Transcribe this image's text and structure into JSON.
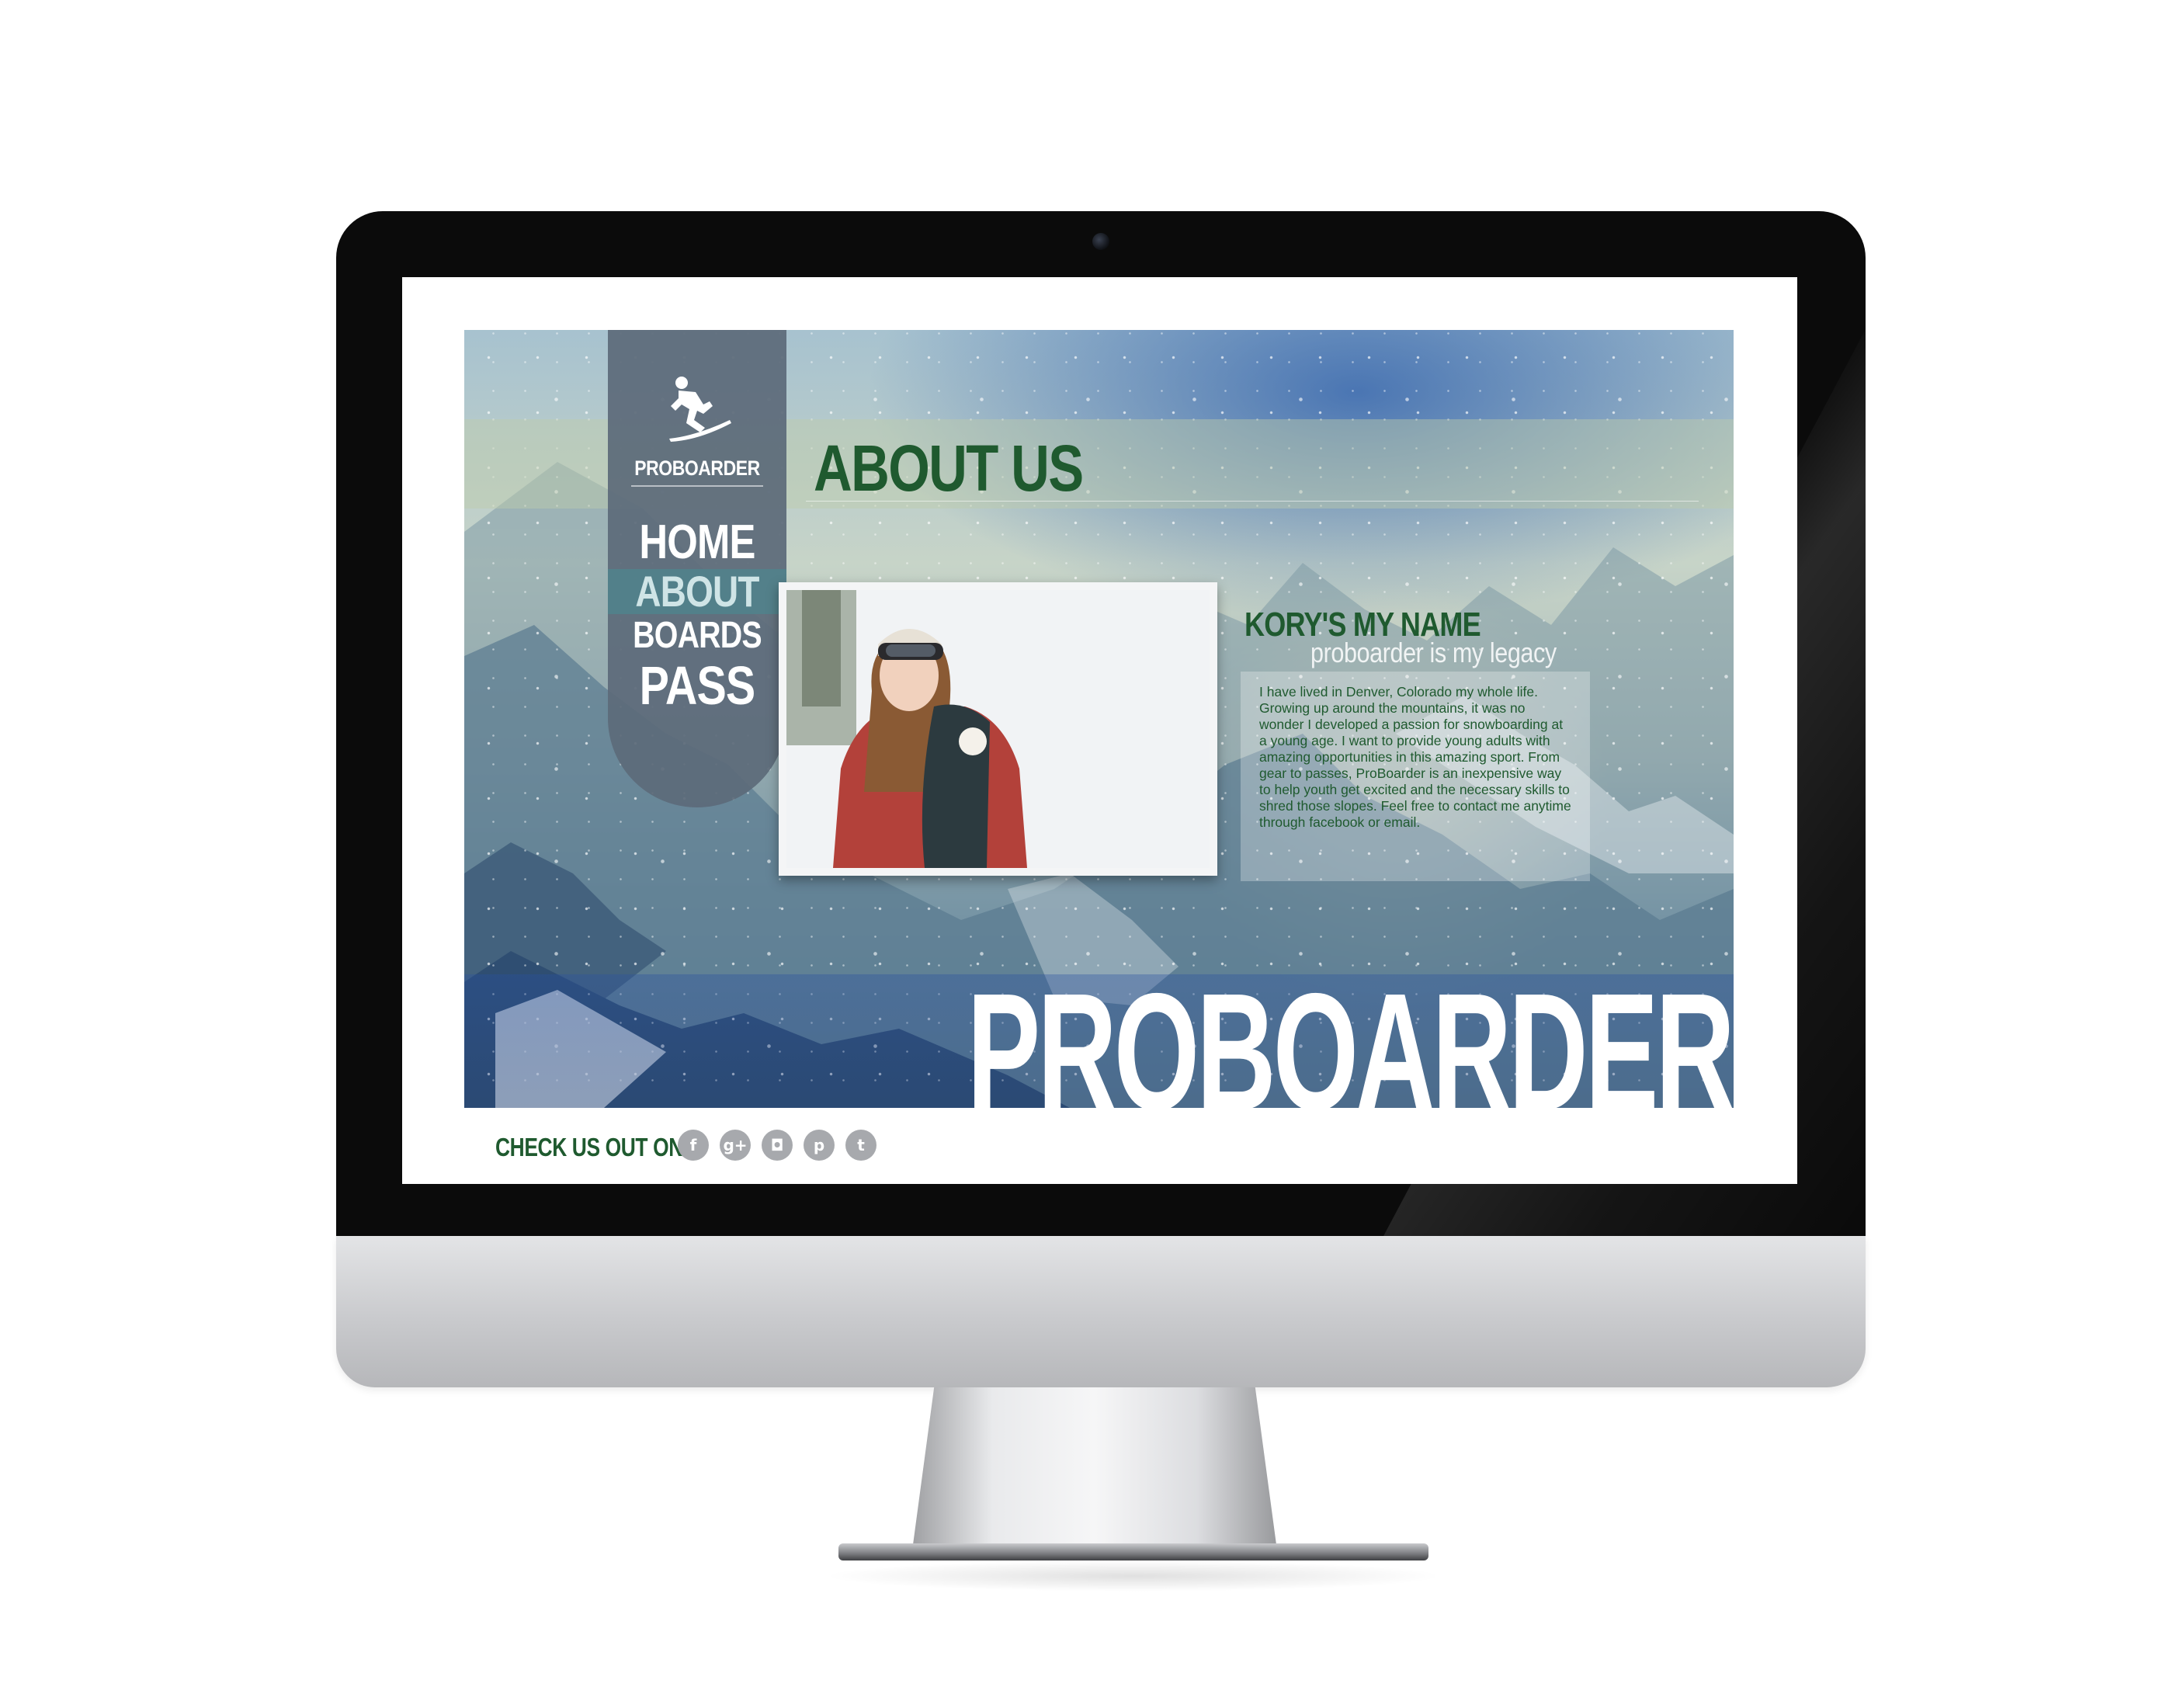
{
  "brand": {
    "logo_text": "PROBOARDER",
    "wordmark": "PROBOARDER"
  },
  "nav": {
    "items": [
      {
        "label": "HOME"
      },
      {
        "label": "ABOUT",
        "active": true
      },
      {
        "label": "BOARDS"
      },
      {
        "label": "PASS"
      }
    ]
  },
  "page": {
    "title": "ABOUT US"
  },
  "profile": {
    "name": "KORY'S MY NAME",
    "tagline": "proboarder is my legacy",
    "bio": "I have lived in Denver, Colorado my whole life. Growing up around the mountains, it was no wonder I developed a passion for snowboarding at a young age. I want to provide young adults with amazing opportunities in this amazing sport. From gear to passes, ProBoarder is an inexpensive way to help youth get excited and the necessary skills to shred those slopes. Feel free to contact me anytime through facebook or email."
  },
  "footer": {
    "label": "CHECK US OUT ON",
    "social": [
      {
        "name": "facebook-icon",
        "glyph": "f"
      },
      {
        "name": "google-plus-icon",
        "glyph": "g+"
      },
      {
        "name": "instagram-icon",
        "glyph": "◘"
      },
      {
        "name": "pinterest-icon",
        "glyph": "p"
      },
      {
        "name": "twitter-icon",
        "glyph": "t"
      }
    ]
  },
  "colors": {
    "accent_green": "#1f5a2f",
    "sidebar": "#5c6a7a",
    "nav_active": "#50828c",
    "social_gray": "#a7a9ad"
  }
}
